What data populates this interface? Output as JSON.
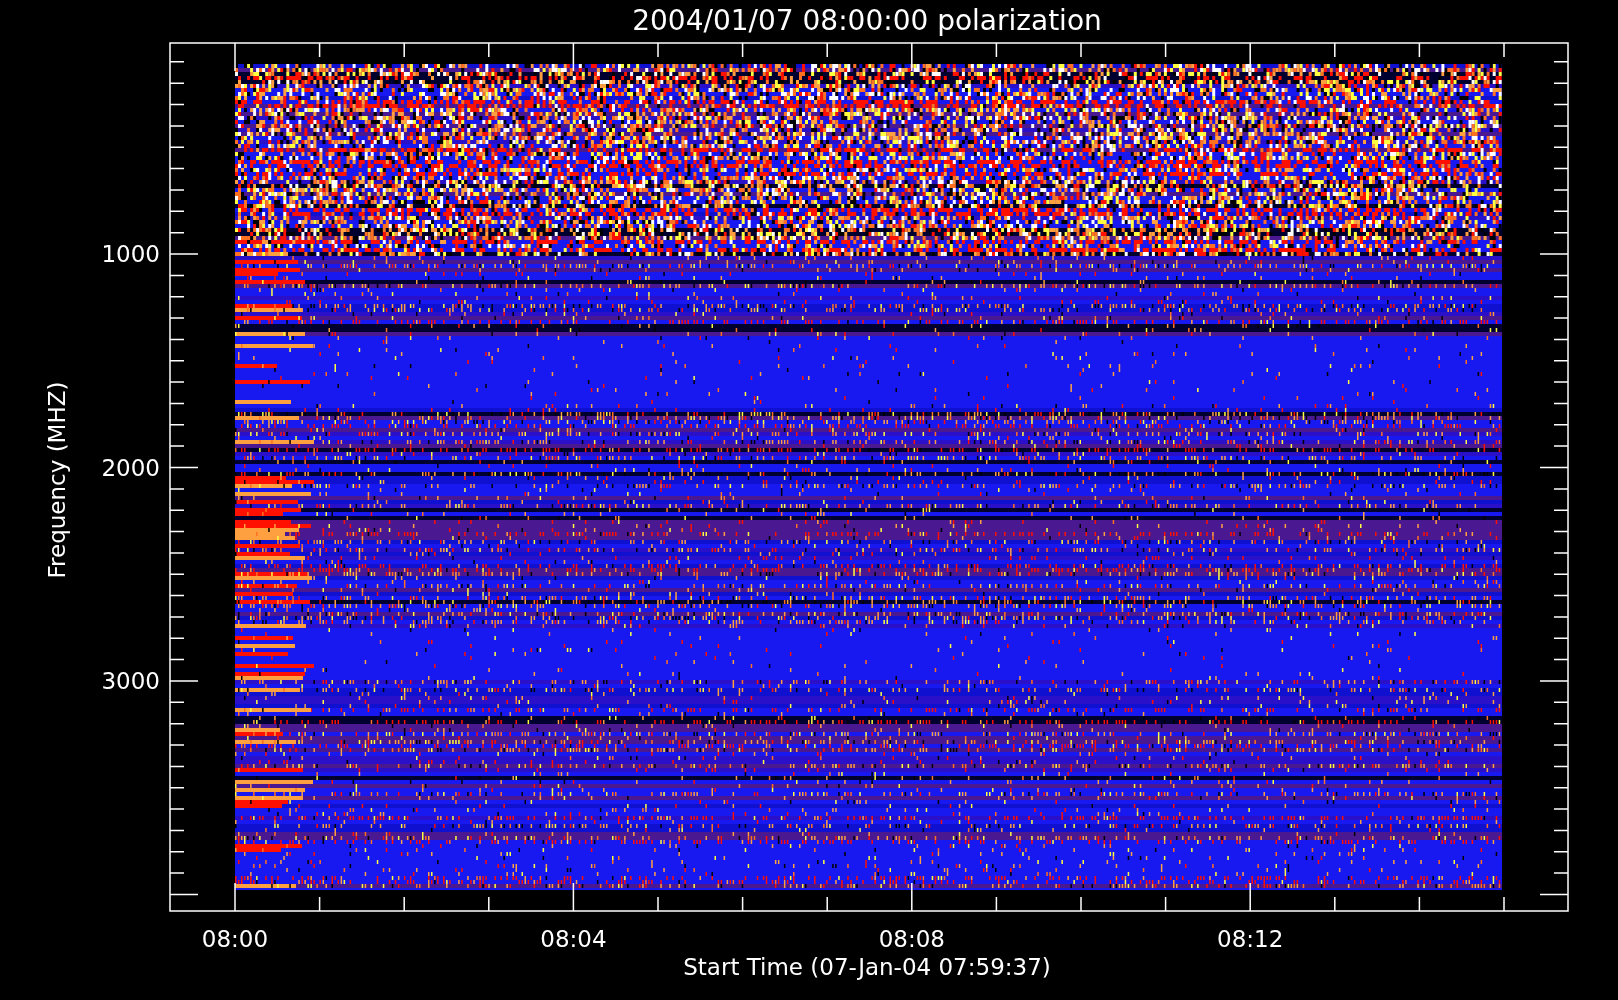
{
  "title": "2004/01/07 08:00:00 polarization",
  "plot": {
    "ylabel": "Frequency (MHZ)",
    "xlabel": "Start Time (07-Jan-04 07:59:37)",
    "yticks": [
      "1000",
      "2000",
      "3000"
    ],
    "xticks": [
      "08:00",
      "08:04",
      "08:08",
      "08:12"
    ]
  }
}
